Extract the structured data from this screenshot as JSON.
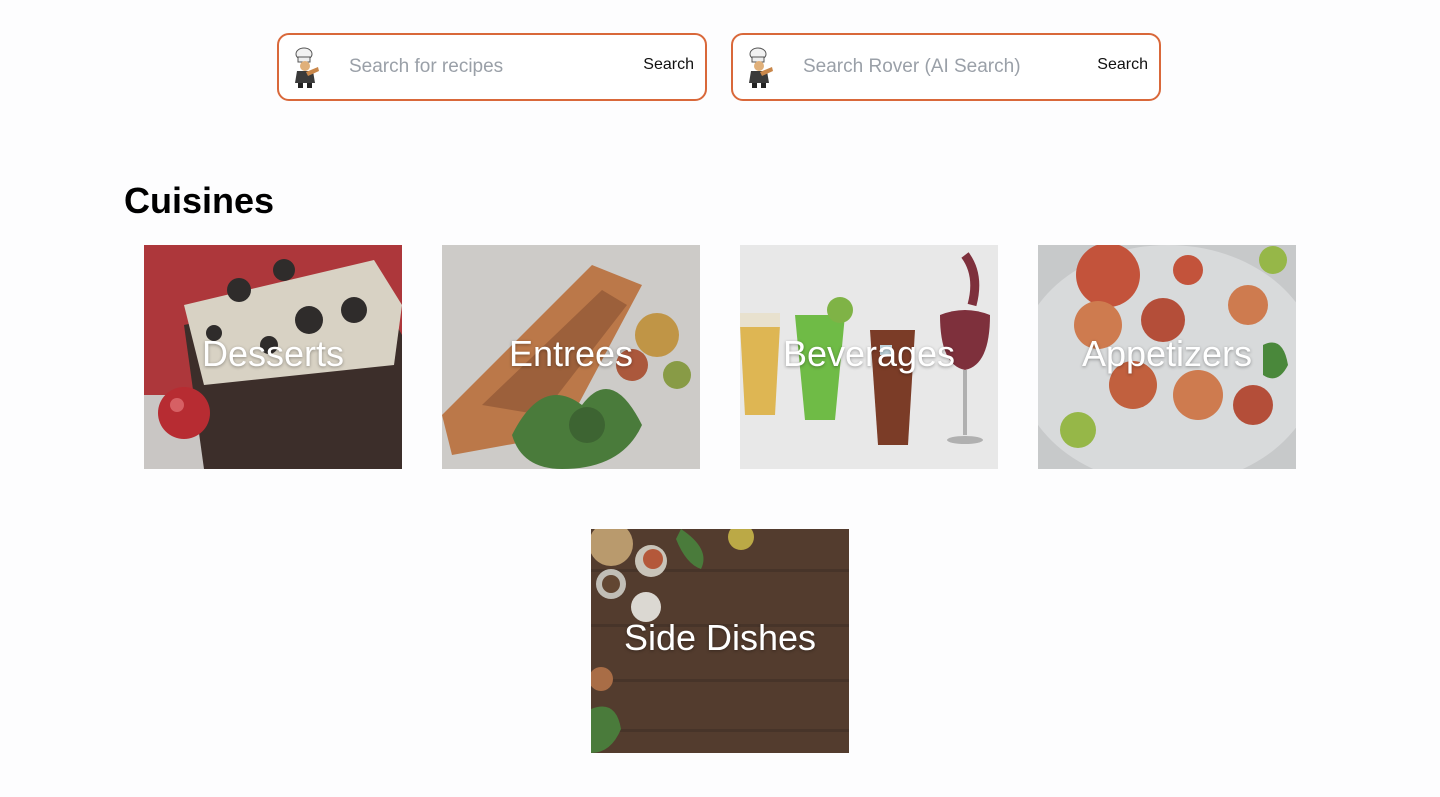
{
  "search_recipes": {
    "placeholder": "Search for recipes",
    "button_label": "Search",
    "icon": "chef-mascot-icon"
  },
  "search_rover": {
    "placeholder": "Search Rover (AI Search)",
    "button_label": "Search",
    "icon": "chef-mascot-icon"
  },
  "section_title": "Cuisines",
  "cuisines": [
    {
      "label": "Desserts"
    },
    {
      "label": "Entrees"
    },
    {
      "label": "Beverages"
    },
    {
      "label": "Appetizers"
    },
    {
      "label": "Side Dishes"
    }
  ],
  "colors": {
    "accent_border": "#d9683a",
    "background": "#fdfdfe",
    "card_text": "#ffffff"
  }
}
